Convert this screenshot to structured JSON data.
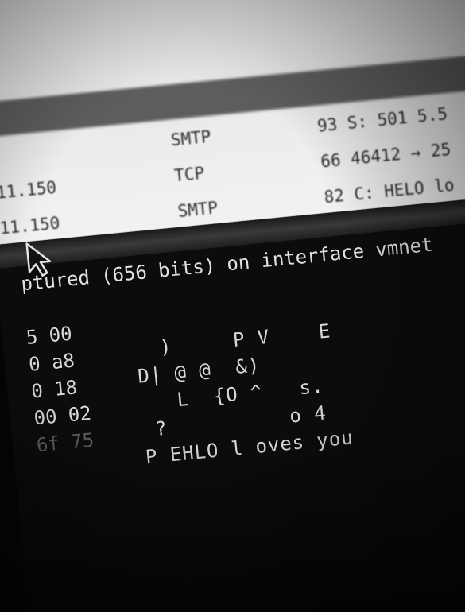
{
  "packet_list": {
    "rows": [
      {
        "src": "",
        "proto": "",
        "info": "",
        "state": "blurred"
      },
      {
        "src": "",
        "proto": "",
        "info": "",
        "state": "blurred"
      },
      {
        "src": "",
        "proto": "",
        "info": "",
        "state": "blurred"
      },
      {
        "src": "",
        "proto": "",
        "info": "",
        "state": "selected"
      },
      {
        "src": "",
        "proto": "SMTP",
        "info": "93 S: 501 5.5",
        "state": "clear"
      },
      {
        "src": "11.150",
        "proto": "TCP",
        "info": "66 46412 → 25",
        "state": "clear"
      },
      {
        "src": "11.150",
        "proto": "SMTP",
        "info": "82 C: HELO lo",
        "state": "clear"
      }
    ]
  },
  "bytes_pane": {
    "frame_info": "ptured (656 bits) on interface vmnet",
    "lines": [
      {
        "hex": "5 00",
        "ascii": "  )     P V    E"
      },
      {
        "hex": "0 a8",
        "ascii": "D| @ @  &)"
      },
      {
        "hex": "0 18",
        "ascii": "   L  {O ^   s."
      },
      {
        "hex": "00 02",
        "ascii": " ?          o 4"
      },
      {
        "hex": "6f 75",
        "ascii": "P EHLO l oves you"
      }
    ]
  },
  "colors": {
    "packet_bg": "#e8e8e8",
    "selected_row": "#5d5d5d",
    "bytes_bg": "#0c0c0c",
    "bytes_text": "#d8d8d8"
  },
  "icons": {
    "cursor": "arrow-cursor-icon"
  }
}
